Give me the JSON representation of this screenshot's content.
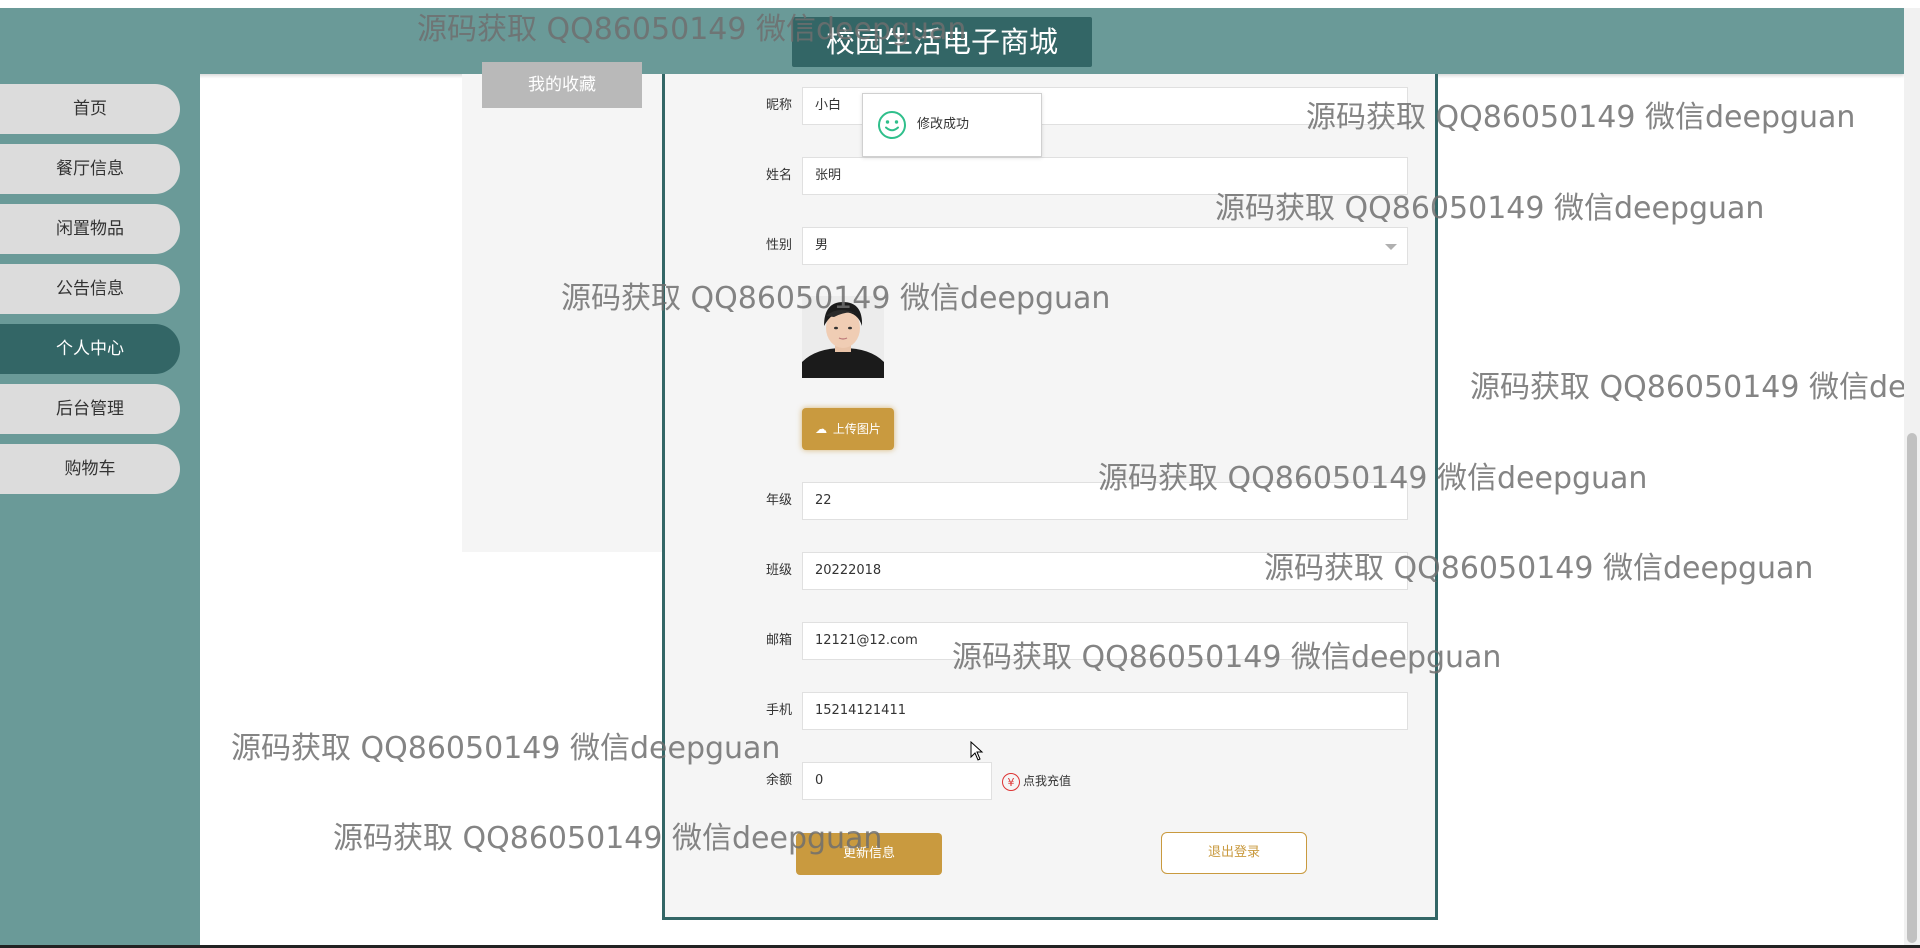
{
  "header": {
    "title": "校园生活电子商城"
  },
  "sidebar": {
    "items": [
      {
        "label": "首页"
      },
      {
        "label": "餐厅信息"
      },
      {
        "label": "闲置物品"
      },
      {
        "label": "公告信息"
      },
      {
        "label": "个人中心",
        "active": true
      },
      {
        "label": "后台管理"
      },
      {
        "label": "购物车"
      }
    ]
  },
  "left_panel": {
    "favorites_button": "我的收藏"
  },
  "form": {
    "nickname": {
      "label": "昵称",
      "value": "小白"
    },
    "name": {
      "label": "姓名",
      "value": "张明"
    },
    "gender": {
      "label": "性别",
      "value": "男"
    },
    "upload_button": "上传图片",
    "grade": {
      "label": "年级",
      "value": "22"
    },
    "class": {
      "label": "班级",
      "value": "20222018"
    },
    "email": {
      "label": "邮箱",
      "value": "12121@12.com"
    },
    "phone": {
      "label": "手机",
      "value": "15214121411"
    },
    "balance": {
      "label": "余额",
      "value": "0"
    },
    "recharge_link": "点我充值",
    "recharge_icon": "¥",
    "update_button": "更新信息",
    "logout_button": "退出登录"
  },
  "toast": {
    "message": "修改成功"
  },
  "watermark": {
    "text": "源码获取 QQ86050149 微信deepguan"
  },
  "colors": {
    "header": "#6a9a98",
    "accent_dark": "#336666",
    "button_gold": "#c99a3f",
    "success_green": "#2fbf8b"
  }
}
